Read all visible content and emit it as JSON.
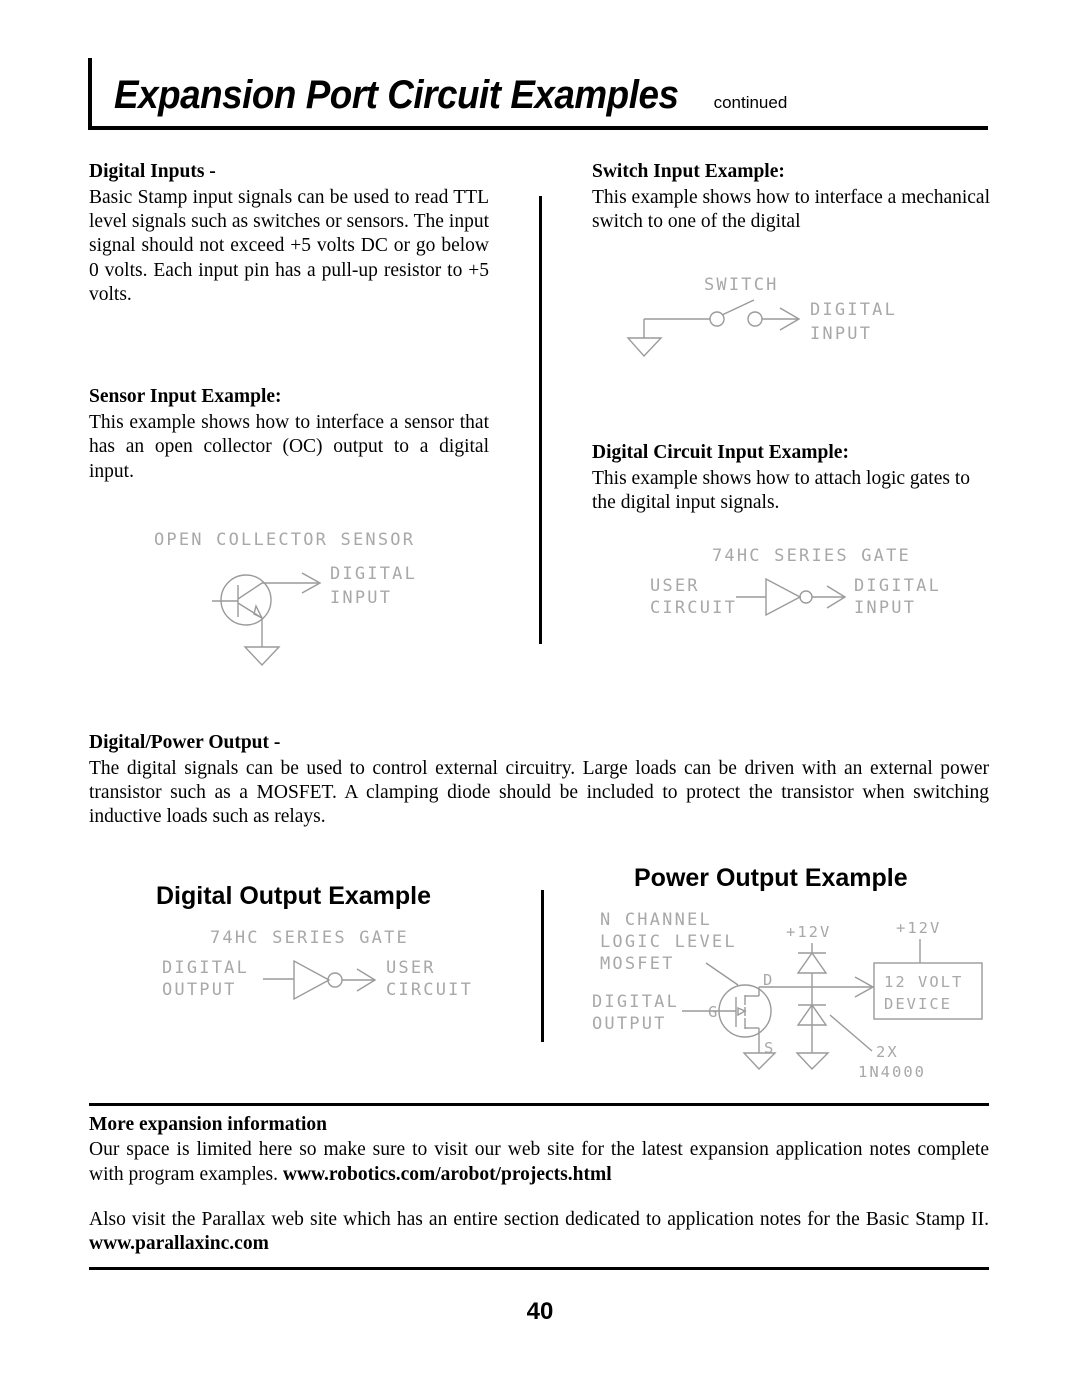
{
  "header": {
    "title": "Expansion Port Circuit Examples",
    "continued": "continued"
  },
  "left_column": {
    "section1": {
      "heading": "Digital Inputs -",
      "body": "Basic Stamp input signals can be used to read TTL level signals such as switches or sensors.  The input signal should not exceed +5 volts DC or go below 0 volts.  Each input pin has a pull-up resistor to +5 volts."
    },
    "section2": {
      "heading": "Sensor Input Example:",
      "body": "This example shows how to interface a sensor that has an open collector (OC) output to a digital input."
    },
    "sensor_diagram": {
      "title": "OPEN COLLECTOR SENSOR",
      "label_line1": "DIGITAL",
      "label_line2": "INPUT"
    }
  },
  "right_column": {
    "section1": {
      "heading": "Switch Input Example:",
      "body": "This example shows how to interface a mechanical switch to one of the digital"
    },
    "switch_diagram": {
      "title": "SWITCH",
      "label_line1": "DIGITAL",
      "label_line2": "INPUT"
    },
    "section2": {
      "heading": "Digital Circuit Input Example:",
      "body": "This example shows how to attach logic gates to the digital input signals."
    },
    "gate_diagram": {
      "title": "74HC SERIES GATE",
      "in_line1": "USER",
      "in_line2": "CIRCUIT",
      "out_line1": "DIGITAL",
      "out_line2": "INPUT"
    }
  },
  "power_section": {
    "heading": "Digital/Power Output -",
    "body": "The digital signals can be used to control external circuitry.  Large loads can be driven with an external power transistor such as a MOSFET.  A clamping diode should be included to protect the transistor when switching inductive loads such as relays."
  },
  "digital_output_example": {
    "title": "Digital Output Example",
    "diagram": {
      "title": "74HC SERIES GATE",
      "in_line1": "DIGITAL",
      "in_line2": "OUTPUT",
      "out_line1": "USER",
      "out_line2": "CIRCUIT"
    }
  },
  "power_output_example": {
    "title": "Power Output Example",
    "diagram": {
      "mosfet_line1": "N CHANNEL",
      "mosfet_line2": "LOGIC LEVEL",
      "mosfet_line3": "MOSFET",
      "in_line1": "DIGITAL",
      "in_line2": "OUTPUT",
      "gate_label": "G",
      "drain_label": "D",
      "source_label": "S",
      "supply_left": "+12V",
      "supply_right": "+12V",
      "device_line1": "12 VOLT",
      "device_line2": "DEVICE",
      "diode_line1": "2X",
      "diode_line2": "1N4000"
    }
  },
  "footer": {
    "heading": "More expansion information",
    "para1_a": "Our space is limited here so make sure to visit our web site for the latest expansion application notes complete with program examples.  ",
    "para1_url": "www.robotics.com/arobot/projects.html",
    "para2_a": "Also visit the Parallax web site which has an entire section dedicated to application notes for the Basic Stamp II.  ",
    "para2_url": "www.parallaxinc.com"
  },
  "page_number": "40"
}
